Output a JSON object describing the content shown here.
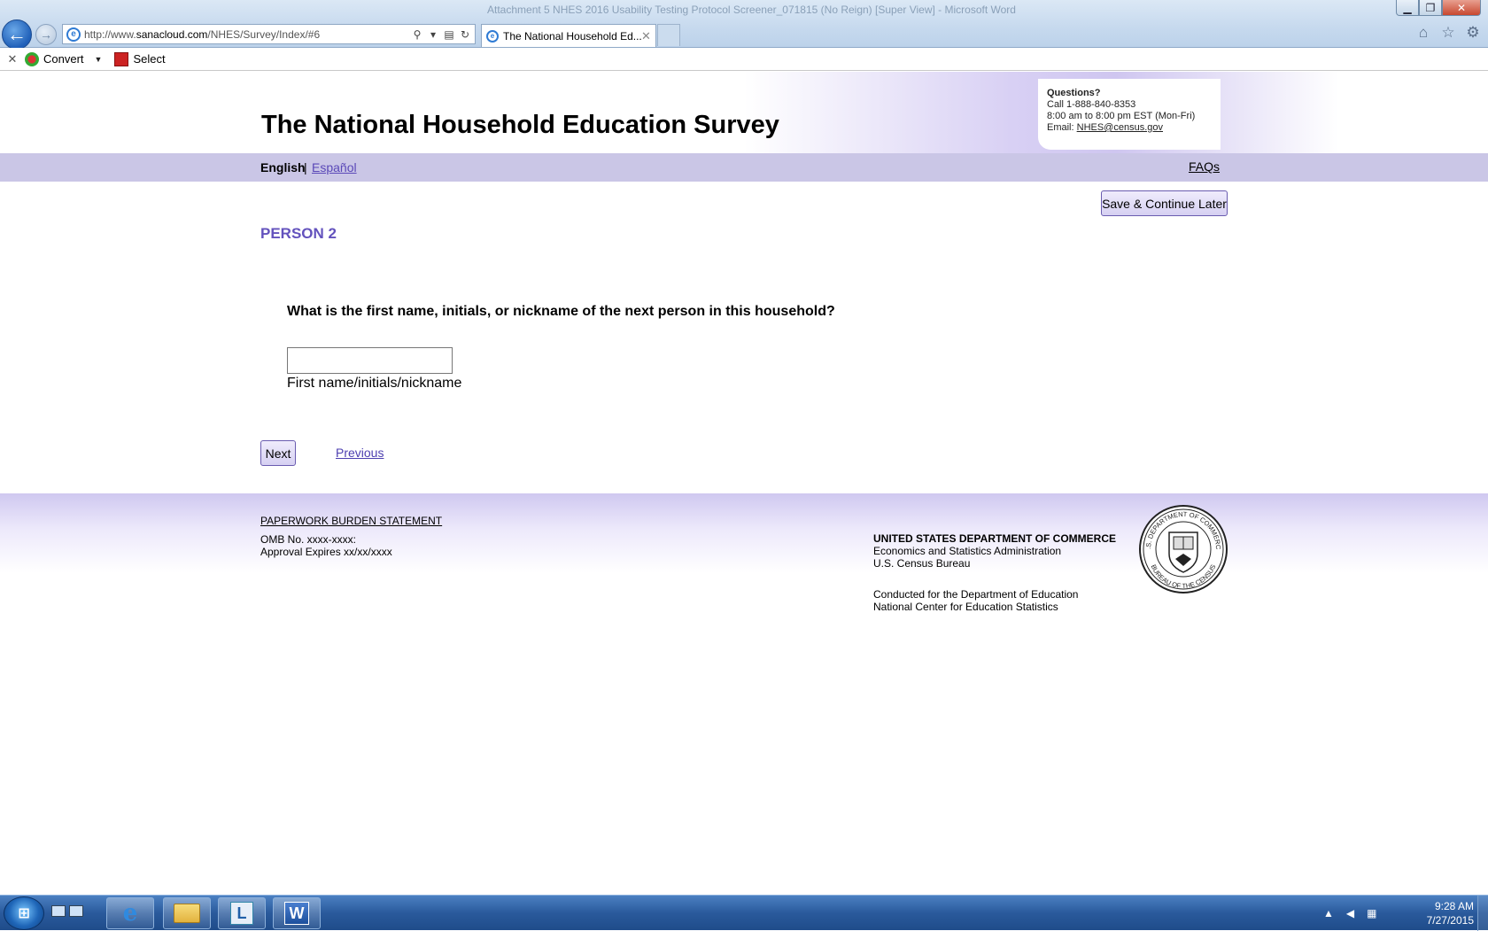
{
  "browser": {
    "title_text": "Attachment 5 NHES 2016 Usability Testing Protocol Screener_071815 (No Reign) [Super View] - Microsoft Word",
    "url_prefix": "http://www.",
    "url_host": "sanacloud.com",
    "url_path": "/NHES/Survey/Index/#6",
    "tab_title": "The National Household Ed...",
    "command_bar": {
      "convert_label": "Convert",
      "select_label": "Select"
    }
  },
  "header": {
    "site_title": "The National Household Education Survey",
    "contact": {
      "heading": "Questions?",
      "phone_line": "Call 1-888-840-8353",
      "hours_line": "8:00 am to 8:00 pm EST (Mon-Fri)",
      "email_prefix": "Email: ",
      "email": "NHES@census.gov"
    }
  },
  "nav": {
    "english": "English",
    "separator": "|",
    "espanol": "Español",
    "faqs": "FAQs"
  },
  "main": {
    "save_label": "Save & Continue Later",
    "person_heading": "PERSON 2",
    "question": "What is the first name, initials, or nickname of the next person in this household?",
    "name_input_value": "",
    "name_label": "First name/initials/nickname",
    "next_label": "Next",
    "previous_label": "Previous"
  },
  "footer": {
    "paperwork_link": "PAPERWORK BURDEN STATEMENT",
    "omb_line": "OMB No. xxxx-xxxx:",
    "approval_line": "Approval Expires xx/xx/xxxx",
    "dept_name": "UNITED STATES DEPARTMENT OF COMMERCE",
    "dept_line2": "Economics and Statistics Administration",
    "dept_line3": "U.S. Census Bureau",
    "conducted_line1": "Conducted for the Department of Education",
    "conducted_line2": "National Center for Education Statistics",
    "seal_top_text": "U.S. DEPARTMENT OF COMMERCE",
    "seal_bottom_text": "BUREAU OF THE CENSUS"
  },
  "taskbar": {
    "time": "9:28 AM",
    "date": "7/27/2015",
    "word_letter": "W",
    "lync_letter": "L"
  },
  "colors": {
    "accent_purple": "#6352bd",
    "nav_band": "#cac6e6",
    "link_purple": "#5a48b8"
  }
}
